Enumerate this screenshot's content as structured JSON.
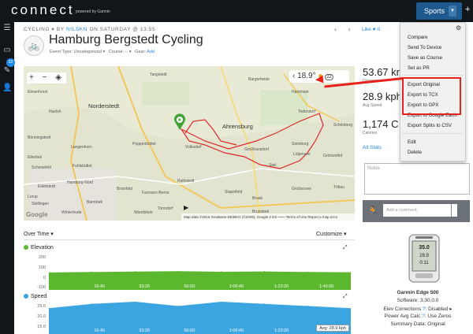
{
  "header": {
    "logo": "connect",
    "powered": "powered by Garmin",
    "sports_label": "Sports",
    "caret": "▾",
    "plus": "+"
  },
  "sidebar": {
    "badge_count": "22"
  },
  "activity": {
    "breadcrumb_prefix": "CYCLING ▾ BY",
    "author": "NILSKN",
    "breadcrumb_suffix": "ON SATURDAY @ 13:55",
    "title": "Hamburg Bergstedt Cycling",
    "event_type": "Event Type: Uncategorized ▾",
    "course": "Course: -- ▾",
    "gear_label": "Gear:",
    "gear_add": "Add",
    "like": "Like ♥ 0"
  },
  "map": {
    "temperature": "18.9°",
    "wind": "22",
    "credits": "Map data ©2015 GeoBasis-DE/BKG (©2009), Google   2 km ⎯⎯⎯⎯   Terms of Use   Report a map error",
    "google": "Google",
    "towns": [
      "Norderstedt",
      "Ahrensburg",
      "Hammoor",
      "Todendorf",
      "Schönberg",
      "Großhansdorf",
      "Siek",
      "Lütjensee",
      "Grönwohld",
      "Großensee",
      "Trittau",
      "Stapelfeld",
      "Braak",
      "Brunsbek",
      "Bargteheide",
      "Tangstedt",
      "Elmenhorst",
      "Hasloh",
      "Bönningstedt",
      "Ellerbek",
      "Schenefeld",
      "Eidelstedt",
      "Langenhorn",
      "Fuhlsbüttel",
      "Hamburg-Nord",
      "Barmbek",
      "Bramfeld",
      "Farmsen-Berne",
      "Rahlstedt",
      "Wandsbek",
      "Stellingen",
      "Lurup",
      "Poppenbüttel",
      "Volksdorf",
      "Steinburg",
      "Tonndorf",
      "Winterhude"
    ]
  },
  "stats": {
    "distance_value": "53.67 km",
    "distance_label": "Distance",
    "speed_value": "28.9 kph",
    "speed_label": "Avg Speed",
    "calories_value": "1,174 C",
    "calories_label": "Calories",
    "all_stats": "All Stats"
  },
  "notes_placeholder": "Notes",
  "comment_placeholder": "Add a comment:",
  "menu": {
    "items": [
      "Compare",
      "Send To Device",
      "Save as Course",
      "Set as PR",
      "Export Original",
      "Export to TCX",
      "Export to GPX",
      "Export to Google Earth",
      "Export Splits to CSV",
      "Edit",
      "Delete"
    ]
  },
  "chart_header": {
    "over_time": "Over Time ▾",
    "customize": "Customize ▾"
  },
  "chart_data": [
    {
      "type": "area",
      "title": "Elevation",
      "color": "#5bb82e",
      "ylim": [
        -100,
        200
      ],
      "yticks": [
        "200",
        "100",
        "0",
        "-100"
      ],
      "x": [
        "0:00",
        "0:16:40",
        "0:33:20",
        "0:50:00",
        "1:06:40",
        "1:23:20",
        "1:40:00",
        "1:51:00"
      ],
      "xticks": [
        "16:40",
        "33:20",
        "50:00",
        "1:06:40",
        "1:23:20",
        "1:40:00"
      ],
      "series": [
        {
          "values": [
            38,
            42,
            45,
            48,
            44,
            46,
            42,
            40
          ]
        }
      ]
    },
    {
      "type": "area",
      "title": "Speed",
      "color": "#3aa5e0",
      "ylim": [
        15,
        30
      ],
      "yticks": [
        "25.0",
        "20.0",
        "15.0"
      ],
      "avg_label": "Avg: 28.9 kph",
      "x": [
        "0:00",
        "0:16:40",
        "0:33:20",
        "0:50:00",
        "1:06:40",
        "1:23:20",
        "1:40:00",
        "1:51:00"
      ],
      "xticks": [
        "16:40",
        "33:20",
        "50:00",
        "1:06:40",
        "1:23:20",
        "1:40:00"
      ],
      "series": [
        {
          "values": [
            27,
            29,
            30,
            28,
            30,
            29,
            28,
            27
          ]
        }
      ]
    }
  ],
  "device": {
    "screen_top": "35.0",
    "screen_mid": "28.9",
    "screen_bot": "0:11",
    "name": "Garmin Edge 500",
    "software": "Software: 3.30.0.0",
    "elev_corrections_label": "Elev Corrections",
    "elev_corrections_value": ": Disabled ▸",
    "power_label": "Power Avg Calc",
    "power_value": ": Use Zeros",
    "summary": "Summary Data: Original"
  }
}
